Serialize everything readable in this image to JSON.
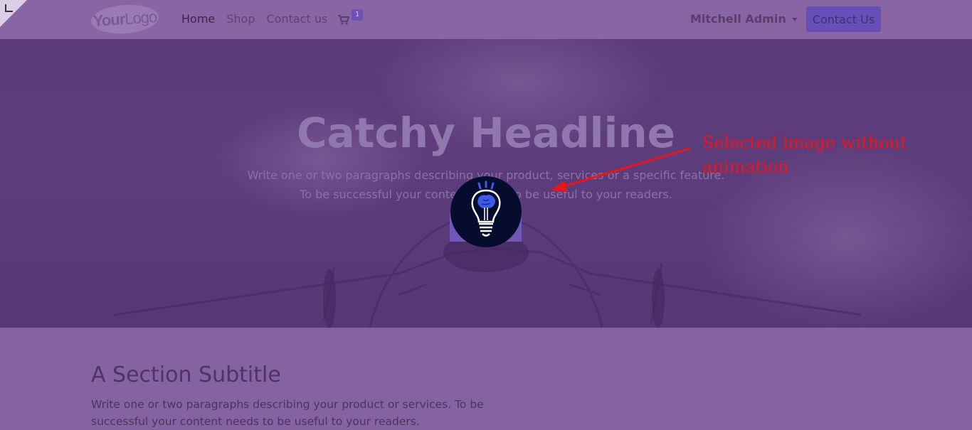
{
  "header": {
    "logo_bold": "Your",
    "logo_light": "Logo",
    "nav": [
      "Home",
      "Shop",
      "Contact us"
    ],
    "cart_count": "1",
    "user_name": "Mitchell Admin",
    "cta_label": "Contact Us"
  },
  "hero": {
    "headline": "Catchy Headline",
    "line1": "Write one or two paragraphs describing your product, services or a specific feature.",
    "line2": "To be successful your content needs to be useful to your readers."
  },
  "annotation": {
    "line1": "Selected image without",
    "line2": "animation"
  },
  "section": {
    "subtitle": "A Section Subtitle",
    "paragraph": "Write one or two paragraphs describing your product or services. To be successful your content needs to be useful to your readers."
  },
  "icons": [
    "cart-icon",
    "lightbulb-brain-icon",
    "caret-down-icon"
  ],
  "colors": {
    "overlay": "#8562a0",
    "annotation": "#e8161a",
    "button": "#6650b8"
  }
}
